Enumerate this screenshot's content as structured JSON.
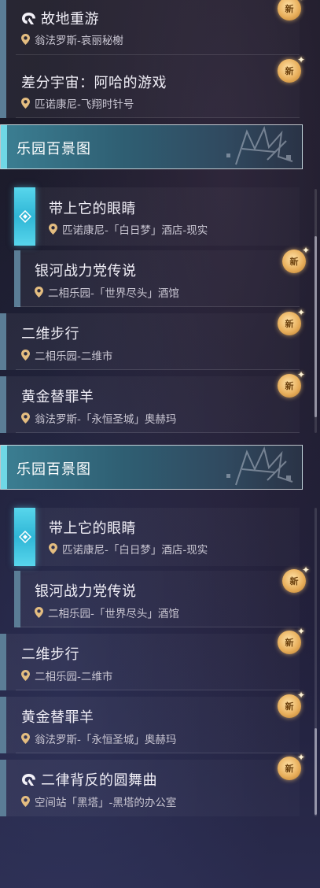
{
  "items_top": [
    {
      "title": "故地重游",
      "location": "翁法罗斯-哀丽秘榭",
      "quest_icon": "quest-icon",
      "new": "新"
    },
    {
      "title": "差分宇宙：阿哈的游戏",
      "location": "匹诺康尼-飞翔时针号",
      "new": "新"
    }
  ],
  "section_1": {
    "header": "乐园百景图",
    "items": [
      {
        "title": "带上它的眼睛",
        "location": "匹诺康尼-「白日梦」酒店-现实",
        "active": true
      },
      {
        "title": "银河战力党传说",
        "location": "二相乐园-「世界尽头」酒馆",
        "new": "新"
      },
      {
        "title": "二维步行",
        "location": "二相乐园-二维市",
        "new": "新"
      },
      {
        "title": "黄金替罪羊",
        "location": "翁法罗斯-「永恒圣城」奥赫玛",
        "new": "新"
      }
    ]
  },
  "section_2": {
    "header": "乐园百景图",
    "items": [
      {
        "title": "带上它的眼睛",
        "location": "匹诺康尼-「白日梦」酒店-现实",
        "active": true
      },
      {
        "title": "银河战力党传说",
        "location": "二相乐园-「世界尽头」酒馆",
        "new": "新"
      },
      {
        "title": "二维步行",
        "location": "二相乐园-二维市",
        "new": "新"
      },
      {
        "title": "黄金替罪羊",
        "location": "翁法罗斯-「永恒圣城」奥赫玛",
        "new": "新"
      },
      {
        "title": "二律背反的圆舞曲",
        "location": "空间站「黑塔」-黑塔的办公室",
        "quest_icon": "quest-icon",
        "new": "新"
      }
    ]
  },
  "colors": {
    "accent_cyan": "#6fd7e6",
    "bar_blue": "#5b7d96",
    "badge_gold": "#e9b05d"
  }
}
